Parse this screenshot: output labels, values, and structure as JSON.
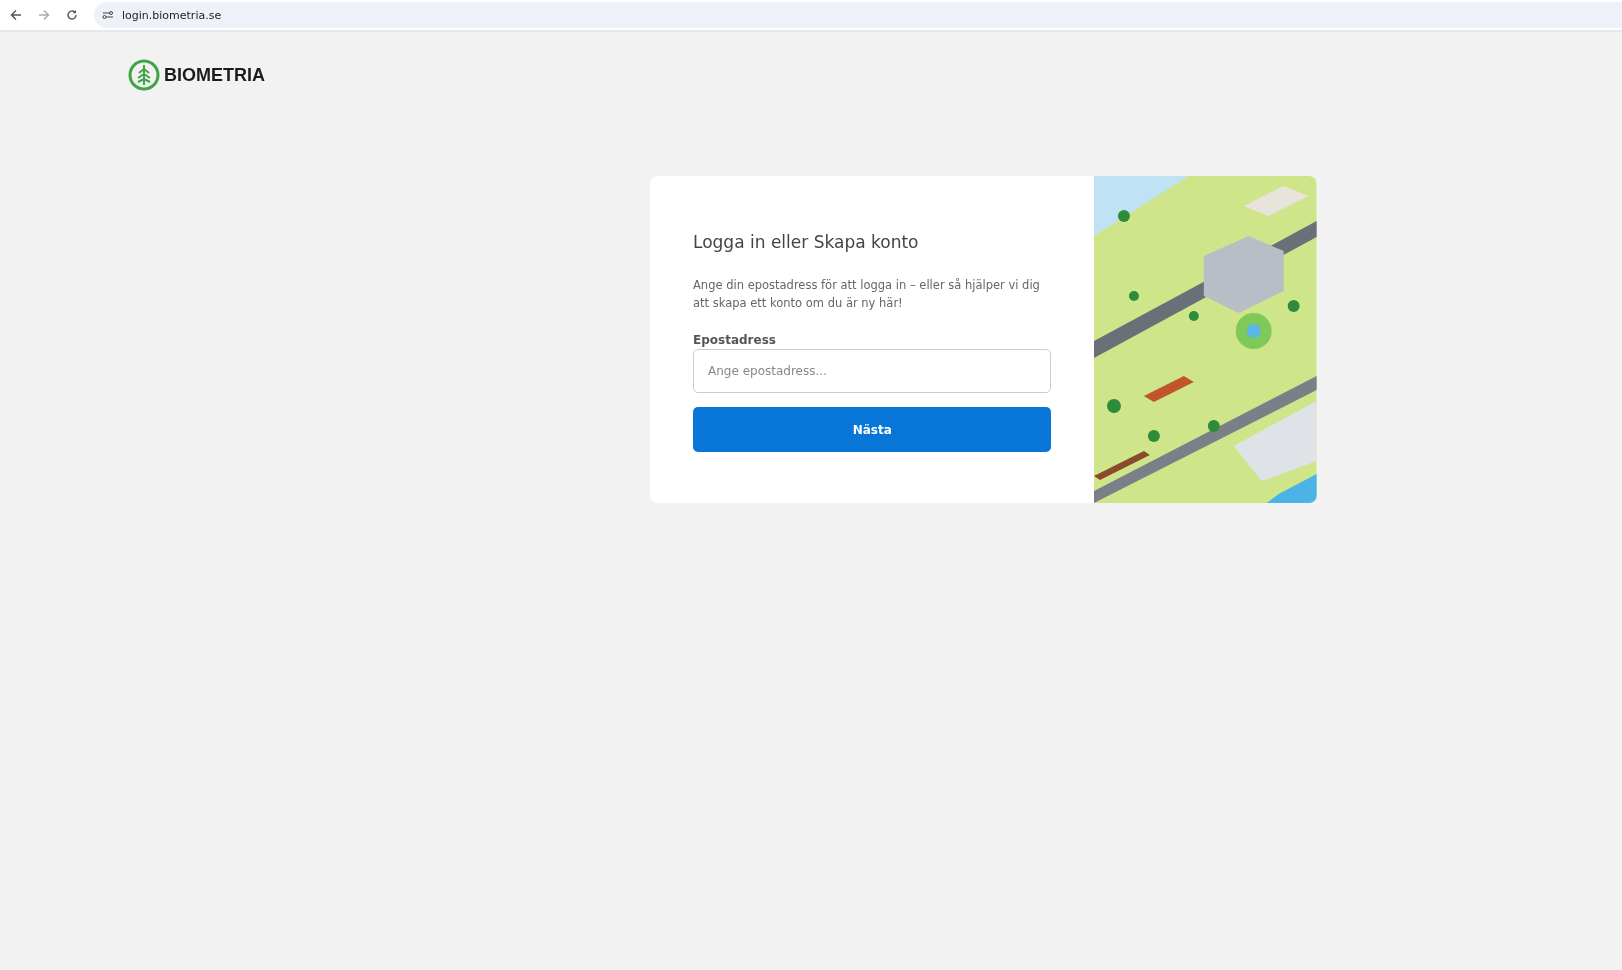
{
  "browser": {
    "url": "login.biometria.se"
  },
  "logo": {
    "text": "BIOMETRIA"
  },
  "login": {
    "title": "Logga in eller Skapa konto",
    "description": "Ange din epostadress för att logga in – eller så hjälper vi dig att skapa ett konto om du är ny här!",
    "field_label": "Epostadress",
    "placeholder": "Ange epostadress...",
    "button": "Nästa"
  }
}
